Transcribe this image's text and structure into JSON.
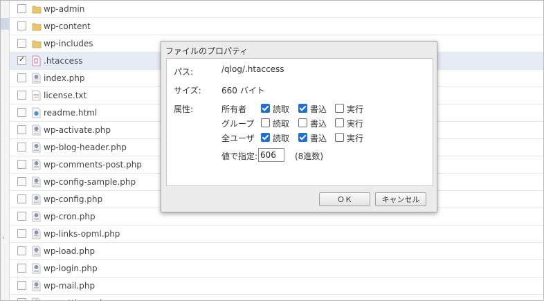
{
  "files": [
    {
      "name": "wp-admin",
      "type": "folder",
      "checked": false
    },
    {
      "name": "wp-content",
      "type": "folder",
      "checked": false
    },
    {
      "name": "wp-includes",
      "type": "folder",
      "checked": false
    },
    {
      "name": ".htaccess",
      "type": "htaccess",
      "checked": true
    },
    {
      "name": "index.php",
      "type": "php",
      "checked": false
    },
    {
      "name": "license.txt",
      "type": "txt",
      "checked": false
    },
    {
      "name": "readme.html",
      "type": "html",
      "checked": false
    },
    {
      "name": "wp-activate.php",
      "type": "php",
      "checked": false
    },
    {
      "name": "wp-blog-header.php",
      "type": "php",
      "checked": false
    },
    {
      "name": "wp-comments-post.php",
      "type": "php",
      "checked": false
    },
    {
      "name": "wp-config-sample.php",
      "type": "php",
      "checked": false
    },
    {
      "name": "wp-config.php",
      "type": "php",
      "checked": false
    },
    {
      "name": "wp-cron.php",
      "type": "php",
      "checked": false
    },
    {
      "name": "wp-links-opml.php",
      "type": "php",
      "checked": false
    },
    {
      "name": "wp-load.php",
      "type": "php",
      "checked": false
    },
    {
      "name": "wp-login.php",
      "type": "php",
      "checked": false
    },
    {
      "name": "wp-mail.php",
      "type": "php",
      "checked": false
    },
    {
      "name": "wp-settings.php",
      "type": "php",
      "checked": false
    }
  ],
  "dialog": {
    "title": "ファイルのプロパティ",
    "path_label": "パス:",
    "path_value": "/qlog/.htaccess",
    "size_label": "サイズ:",
    "size_value": "660 バイト",
    "attr_label": "属性:",
    "perm_cols": [
      "読取",
      "書込",
      "実行"
    ],
    "perm_rows": [
      {
        "label": "所有者",
        "values": [
          true,
          true,
          false
        ]
      },
      {
        "label": "グループ",
        "values": [
          false,
          false,
          false
        ]
      },
      {
        "label": "全ユーザ",
        "values": [
          true,
          true,
          false
        ]
      }
    ],
    "numeric_label": "値で指定:",
    "numeric_value": "606",
    "numeric_note": "(8進数)",
    "ok_label": "ＯＫ",
    "cancel_label": "キャンセル"
  },
  "colors": {
    "checkbox_on": "#1f6fd6",
    "selected_row": "#e7ebf5",
    "folder": "#e8c66a"
  }
}
